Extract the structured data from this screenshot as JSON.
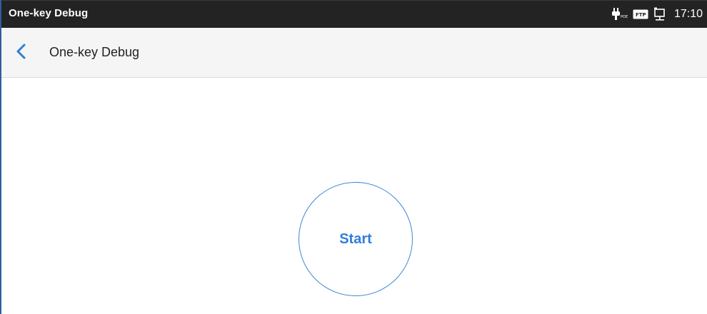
{
  "status_bar": {
    "title": "One-key Debug",
    "time": "17:10",
    "icons": [
      "poe-plug-icon",
      "ftp-icon",
      "network-monitor-icon"
    ],
    "poe_text": "POE",
    "ftp_text": "FTP"
  },
  "header": {
    "back_icon": "chevron-left-icon",
    "title": "One-key Debug"
  },
  "main": {
    "start_label": "Start"
  },
  "colors": {
    "status_bar_bg": "#232323",
    "header_bg": "#f5f5f5",
    "accent": "#2f7ed8"
  }
}
